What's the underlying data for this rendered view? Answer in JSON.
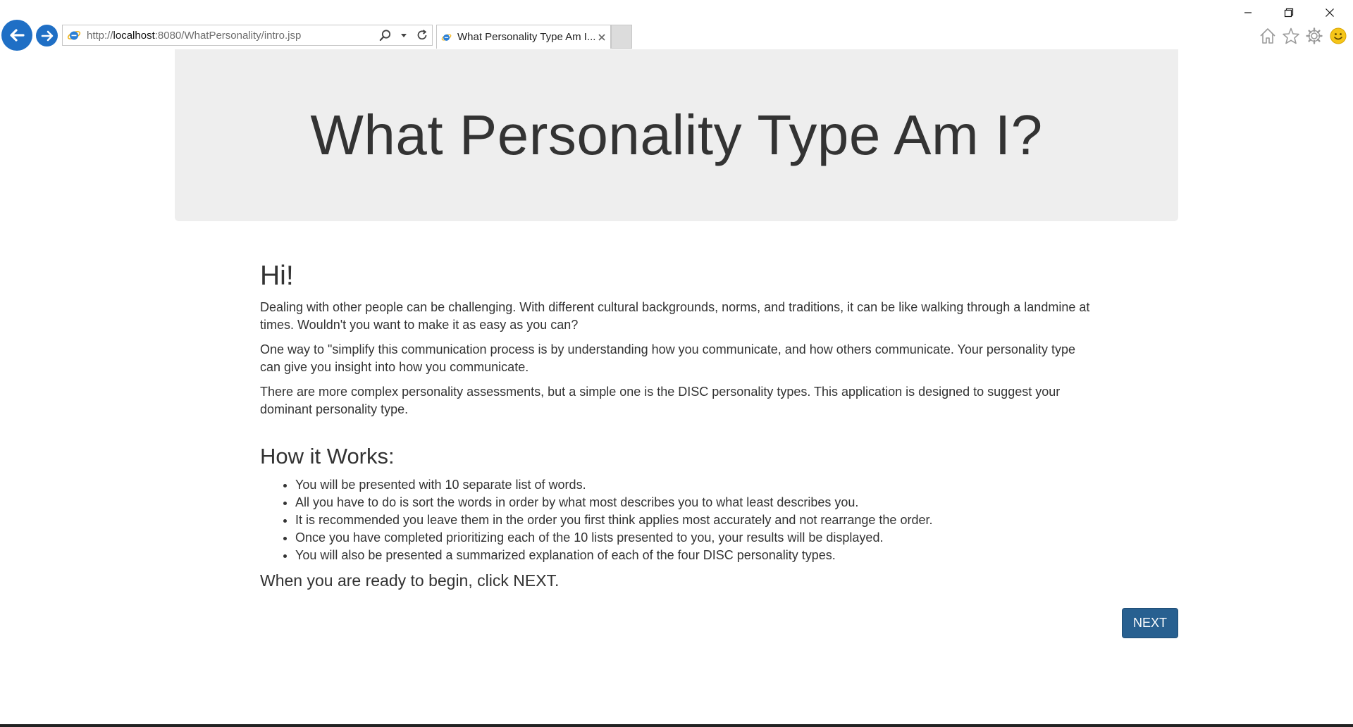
{
  "browser": {
    "url_prefix": "http://",
    "url_host": "localhost",
    "url_rest": ":8080/WhatPersonality/intro.jsp",
    "tab_title": "What Personality Type Am I...",
    "colors": {
      "nav_blue": "#1f6fc5",
      "ie_blue": "#2a7fd6",
      "ie_ring": "#f2b417"
    },
    "icons": [
      "back-arrow-icon",
      "forward-arrow-icon",
      "ie-logo-icon",
      "search-icon",
      "dropdown-icon",
      "refresh-icon",
      "close-icon",
      "minimize-icon",
      "restore-icon",
      "home-icon",
      "star-icon",
      "gear-icon",
      "smiley-icon"
    ]
  },
  "page": {
    "heading": "What Personality Type Am I?",
    "greeting": "Hi!",
    "paragraphs": [
      "Dealing with other people can be challenging. With different cultural backgrounds, norms, and traditions, it can be like walking through a landmine at times. Wouldn't you want to make it as easy as you can?",
      "One way to \"simplify this communication process is by understanding how you communicate, and how others communicate. Your personality type can give you insight into how you communicate.",
      "There are more complex personality assessments, but a simple one is the DISC personality types. This application is designed to suggest your dominant personality type."
    ],
    "how_title": "How it Works:",
    "steps": [
      "You will be presented with 10 separate list of words.",
      "All you have to do is sort the words in order by what most describes you to what least describes you.",
      "It is recommended you leave them in the order you first think applies most accurately and not rearrange the order.",
      "Once you have completed prioritizing each of the 10 lists presented to you, your results will be displayed.",
      "You will also be presented a summarized explanation of each of the four DISC personality types."
    ],
    "cta": "When you are ready to begin, click NEXT.",
    "next_label": "NEXT",
    "colors": {
      "jumbotron_bg": "#eeeeee",
      "button_bg": "#286090",
      "text": "#333333"
    }
  }
}
